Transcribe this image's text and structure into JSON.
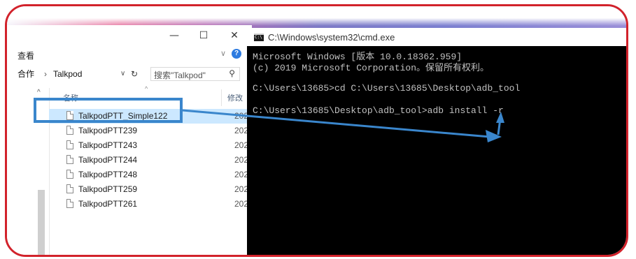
{
  "explorer": {
    "window_controls": {
      "minimize": "—",
      "maximize": "☐",
      "close": "✕"
    },
    "menu": {
      "view": "查看",
      "expand": "∨",
      "help": "?"
    },
    "address": {
      "parent": "合作",
      "separator": "›",
      "current": "Talkpod",
      "dropdown": "∨",
      "refresh": "↻"
    },
    "search": {
      "placeholder": "搜索\"Talkpod\"",
      "icon": "search-icon"
    },
    "columns": {
      "name": "名称",
      "modified": "修改",
      "sort_indicator": "^"
    },
    "nav_up": "^",
    "files": [
      {
        "name": "TalkpodPTT_Simple122",
        "date": "202",
        "selected": true
      },
      {
        "name": "TalkpodPTT239",
        "date": "202",
        "selected": false
      },
      {
        "name": "TalkpodPTT243",
        "date": "202",
        "selected": false
      },
      {
        "name": "TalkpodPTT244",
        "date": "202",
        "selected": false
      },
      {
        "name": "TalkpodPTT248",
        "date": "202",
        "selected": false
      },
      {
        "name": "TalkpodPTT259",
        "date": "202",
        "selected": false
      },
      {
        "name": "TalkpodPTT261",
        "date": "202",
        "selected": false
      }
    ]
  },
  "cmd": {
    "title": "C:\\Windows\\system32\\cmd.exe",
    "lines": [
      "Microsoft Windows [版本 10.0.18362.959]",
      "(c) 2019 Microsoft Corporation。保留所有权利。",
      "",
      "C:\\Users\\13685>cd C:\\Users\\13685\\Desktop\\adb_tool",
      "",
      "C:\\Users\\13685\\Desktop\\adb_tool>adb install -r"
    ]
  },
  "colors": {
    "frame": "#d2222b",
    "annotation": "#3a86cc",
    "selection": "#cce8ff",
    "cmd_bg": "#000000",
    "cmd_text": "#c0c0c0"
  }
}
